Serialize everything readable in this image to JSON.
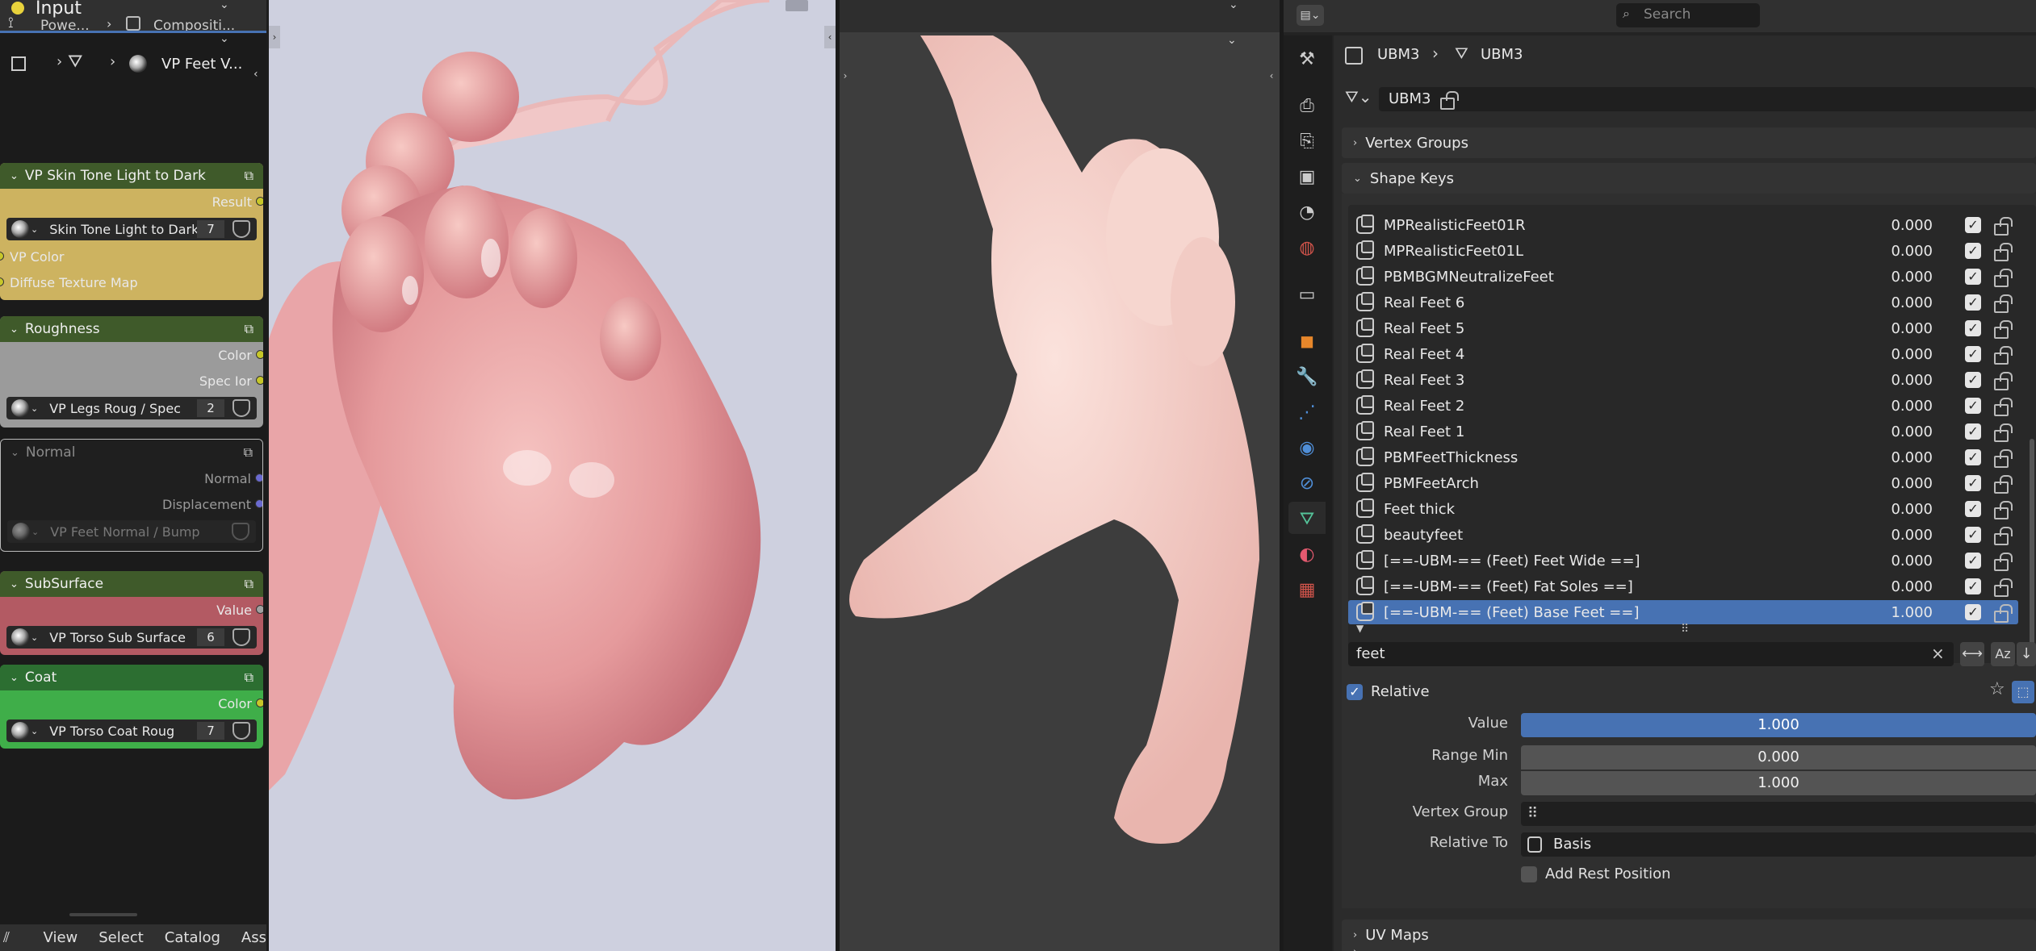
{
  "node_editor": {
    "header": {
      "mode_label": "Input",
      "breadcrumb1": "Powe...",
      "breadcrumb2": "Compositi..."
    },
    "subheader_label": "VP Feet V...",
    "menu": [
      "View",
      "Select",
      "Catalog",
      "Ass"
    ],
    "nodes": [
      {
        "title": "VP Skin Tone Light to Dark",
        "color": "#cdb360",
        "head": "#3f5a2a",
        "output": "Result",
        "datablock": "Skin Tone Light to Dark",
        "users": "7",
        "inputs": [
          "VP Color",
          "Diffuse Texture Map"
        ]
      },
      {
        "title": "Roughness",
        "color": "#9b9b9b",
        "head": "#3f5a2a",
        "outputs": [
          "Color",
          "Spec Ior"
        ],
        "datablock": "VP Legs Roug / Spec",
        "users": "2"
      },
      {
        "title": "Normal",
        "color": "#2a2a2a",
        "head": "#2a2a2a",
        "outputs": [
          "Normal",
          "Displacement"
        ],
        "datablock": "VP Feet Normal / Bump"
      },
      {
        "title": "SubSurface",
        "color": "#b35a63",
        "head": "#3f5a2a",
        "output": "Value",
        "datablock": "VP Torso Sub Surface",
        "users": "6"
      },
      {
        "title": "Coat",
        "color": "#3fae49",
        "head": "#2c6e31",
        "output": "Color",
        "datablock": "VP Torso Coat Roug",
        "users": "7"
      }
    ]
  },
  "properties": {
    "search_placeholder": "Search",
    "breadcrumb": [
      "UBM3",
      "UBM3"
    ],
    "mesh_name": "UBM3",
    "panels": {
      "vertex_groups": "Vertex Groups",
      "shape_keys": "Shape Keys",
      "uv_maps": "UV Maps"
    },
    "shape_keys": [
      {
        "name": "MPRealisticFeet01R",
        "value": "0.000"
      },
      {
        "name": "MPRealisticFeet01L",
        "value": "0.000"
      },
      {
        "name": "PBMBGMNeutralizeFeet",
        "value": "0.000"
      },
      {
        "name": "Real Feet 6",
        "value": "0.000"
      },
      {
        "name": "Real Feet 5",
        "value": "0.000"
      },
      {
        "name": "Real Feet 4",
        "value": "0.000"
      },
      {
        "name": "Real Feet 3",
        "value": "0.000"
      },
      {
        "name": "Real Feet 2",
        "value": "0.000"
      },
      {
        "name": "Real Feet 1",
        "value": "0.000"
      },
      {
        "name": "PBMFeetThickness",
        "value": "0.000"
      },
      {
        "name": "PBMFeetArch",
        "value": "0.000"
      },
      {
        "name": "Feet thick",
        "value": "0.000"
      },
      {
        "name": "beautyfeet",
        "value": "0.000"
      },
      {
        "name": "[==-UBM-== (Feet) Feet Wide ==]",
        "value": "0.000"
      },
      {
        "name": "[==-UBM-== (Feet) Fat Soles ==]",
        "value": "0.000"
      },
      {
        "name": "[==-UBM-== (Feet) Base Feet ==]",
        "value": "1.000",
        "selected": true
      }
    ],
    "filter_text": "feet",
    "relative_label": "Relative",
    "value_label": "Value",
    "value": "1.000",
    "range_min_label": "Range Min",
    "range_min": "0.000",
    "max_label": "Max",
    "max": "1.000",
    "vertex_group_label": "Vertex Group",
    "relative_to_label": "Relative To",
    "relative_to": "Basis",
    "add_rest_label": "Add Rest Position",
    "accent": "#4772b3"
  }
}
